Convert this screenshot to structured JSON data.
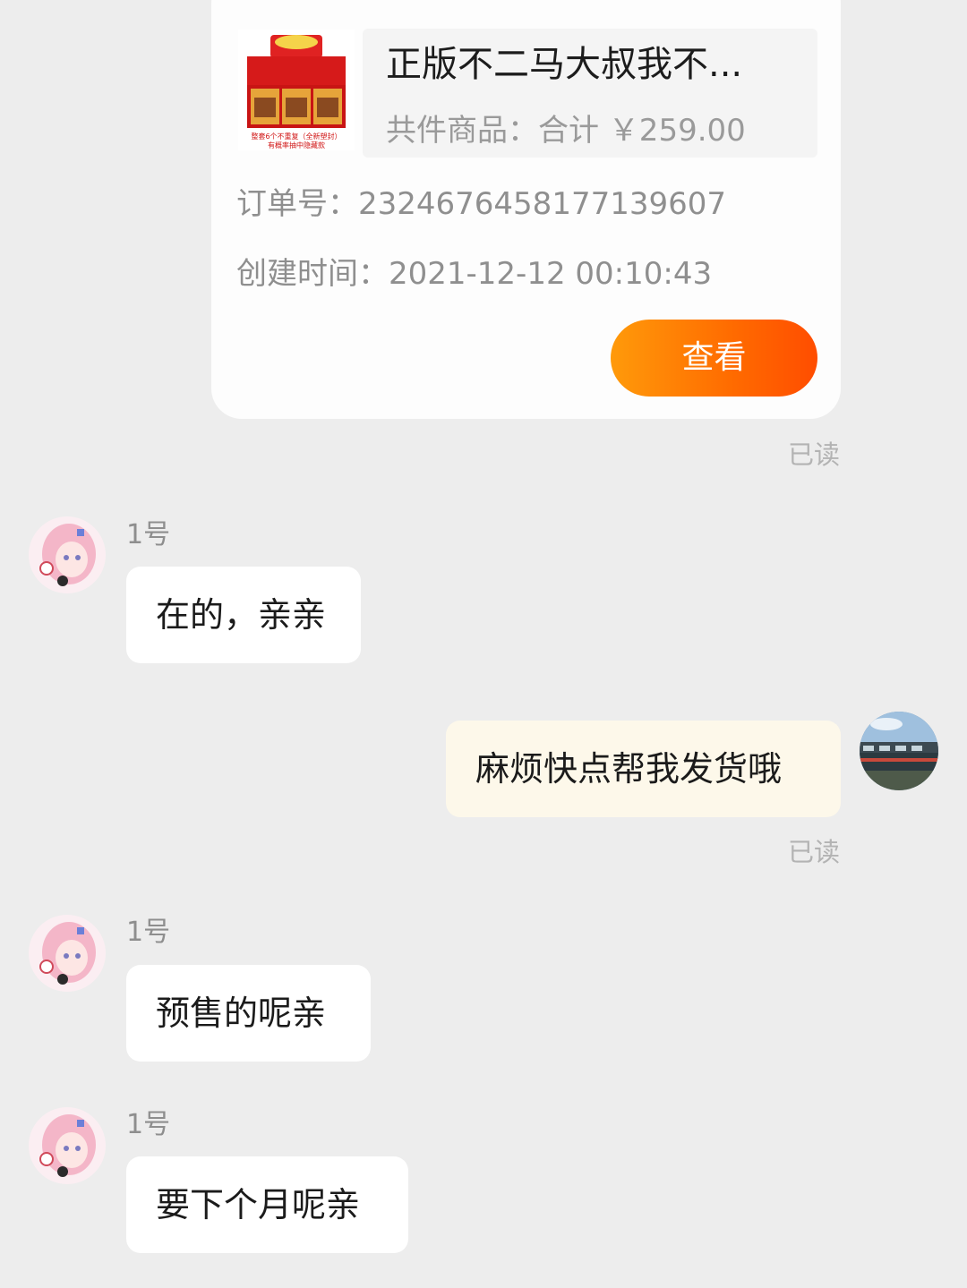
{
  "order_card": {
    "product_title": "正版不二马大叔我不...",
    "product_summary": "共件商品：合计 ￥259.00",
    "order_number": "订单号：2324676458177139607",
    "created_time": "创建时间：2021-12-12 00:10:43",
    "view_button_label": "查看",
    "thumbnail_caption_1": "整套6个不重复（全新塑封）",
    "thumbnail_caption_2": "有概率抽中隐藏款"
  },
  "messages": [
    {
      "type": "receipt",
      "text": "已读"
    },
    {
      "sender": "1号",
      "text": "在的，亲亲"
    },
    {
      "sender": "me",
      "text": "麻烦快点帮我发货哦"
    },
    {
      "type": "receipt",
      "text": "已读"
    },
    {
      "sender": "1号",
      "text": "预售的呢亲"
    },
    {
      "sender": "1号",
      "text": "要下个月呢亲"
    }
  ],
  "colors": {
    "background": "#ededed",
    "accent_orange": "#ff6a00",
    "my_bubble": "#fdf8ea",
    "their_bubble": "#ffffff"
  }
}
